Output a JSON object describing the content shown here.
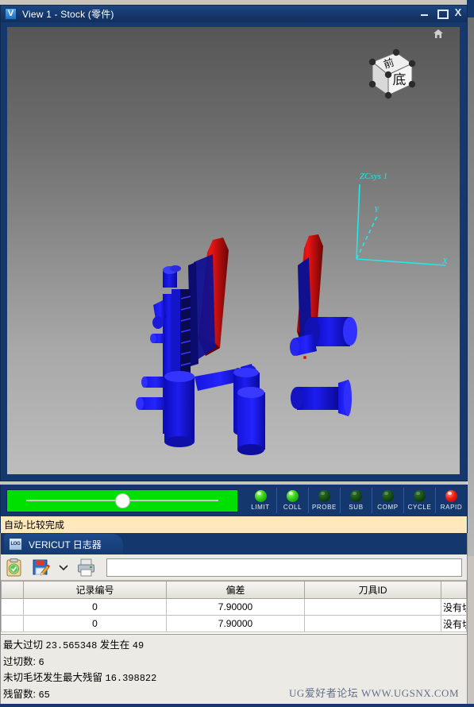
{
  "window": {
    "title": "View 1 - Stock (零件)",
    "icon": "vericut-v-icon",
    "controls": {
      "minimize": "minimize-button",
      "maximize": "maximize-button",
      "close": "close-button",
      "close_glyph": "X"
    }
  },
  "viewport": {
    "viewcube": {
      "top_face_label": "前",
      "front_face_label": "底",
      "home_icon": "home-icon"
    },
    "csys": {
      "label": "ZCsys 1",
      "axes": [
        {
          "name": "Z",
          "label": ""
        },
        {
          "name": "Y",
          "label": "Y"
        },
        {
          "name": "X",
          "label": "X"
        }
      ],
      "color": "#22e8e8"
    },
    "model": {
      "part_color": "#1414e6",
      "highlight_color": "#e81010",
      "background_top": "#565656",
      "background_bottom": "#bdbdbd"
    }
  },
  "status_strip": {
    "progress": {
      "value": 100,
      "fill_color": "#00e000",
      "knob_position_percent": 50
    },
    "lights": [
      {
        "label": "LIMIT",
        "state": "on",
        "color": "#31d117"
      },
      {
        "label": "COLL",
        "state": "on",
        "color": "#31d117"
      },
      {
        "label": "PROBE",
        "state": "off",
        "color": "#12410f"
      },
      {
        "label": "SUB",
        "state": "off",
        "color": "#12410f"
      },
      {
        "label": "COMP",
        "state": "off",
        "color": "#12410f"
      },
      {
        "label": "CYCLE",
        "state": "off",
        "color": "#12410f"
      },
      {
        "label": "RAPID",
        "state": "on",
        "color": "#ee1d12"
      }
    ]
  },
  "message_bar": {
    "text": "自动-比较完成",
    "background": "#ffe8bb"
  },
  "log_panel": {
    "tab": {
      "label": "VERICUT 日志器",
      "icon": "log-book-icon",
      "icon_text": "LOG"
    },
    "toolbar": {
      "buttons": [
        {
          "name": "clipboard-check-icon",
          "tooltip": ""
        },
        {
          "name": "save-edit-icon",
          "tooltip": ""
        },
        {
          "name": "chevron-down-icon",
          "tooltip": ""
        },
        {
          "name": "printer-icon",
          "tooltip": ""
        }
      ],
      "filter_input": {
        "value": "",
        "placeholder": ""
      }
    },
    "table": {
      "columns": [
        "",
        "记录编号",
        "偏差",
        "刀具ID",
        ""
      ],
      "rows": [
        {
          "selector": "",
          "record": "0",
          "deviation": "7.90000",
          "tool_id": "",
          "note": "没有切削"
        },
        {
          "selector": "",
          "record": "0",
          "deviation": "7.90000",
          "tool_id": "",
          "note": "没有切削"
        }
      ]
    },
    "summary": [
      {
        "label": "最大过切",
        "value": "23.565348",
        "label2": "发生在",
        "value2": "49"
      },
      {
        "label": "过切数:",
        "value": "6",
        "label2": "",
        "value2": ""
      },
      {
        "label": "未切毛坯发生最大残留",
        "value": "16.398822",
        "label2": "",
        "value2": ""
      },
      {
        "label": "残留数:",
        "value": "65",
        "label2": "",
        "value2": ""
      }
    ]
  },
  "watermark": {
    "text": "UG爱好者论坛 WWW.UGSNX.COM"
  }
}
